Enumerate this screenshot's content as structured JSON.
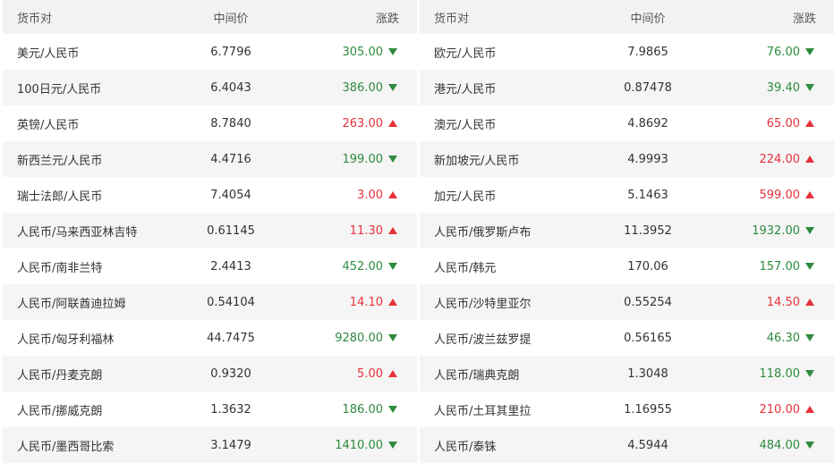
{
  "headers": {
    "pair": "货币对",
    "mid": "中间价",
    "change": "涨跌"
  },
  "colors": {
    "down": "#2e8b3e",
    "up": "#e8313b",
    "header_bg": "#f2f2f2",
    "row_alt_bg": "#f5f5f5"
  },
  "left": [
    {
      "pair": "美元/人民币",
      "mid": "6.7796",
      "change": "305.00",
      "dir": "down"
    },
    {
      "pair": "100日元/人民币",
      "mid": "6.4043",
      "change": "386.00",
      "dir": "down"
    },
    {
      "pair": "英镑/人民币",
      "mid": "8.7840",
      "change": "263.00",
      "dir": "up"
    },
    {
      "pair": "新西兰元/人民币",
      "mid": "4.4716",
      "change": "199.00",
      "dir": "down"
    },
    {
      "pair": "瑞士法郎/人民币",
      "mid": "7.4054",
      "change": "3.00",
      "dir": "up"
    },
    {
      "pair": "人民币/马来西亚林吉特",
      "mid": "0.61145",
      "change": "11.30",
      "dir": "up"
    },
    {
      "pair": "人民币/南非兰特",
      "mid": "2.4413",
      "change": "452.00",
      "dir": "down"
    },
    {
      "pair": "人民币/阿联酋迪拉姆",
      "mid": "0.54104",
      "change": "14.10",
      "dir": "up"
    },
    {
      "pair": "人民币/匈牙利福林",
      "mid": "44.7475",
      "change": "9280.00",
      "dir": "down"
    },
    {
      "pair": "人民币/丹麦克朗",
      "mid": "0.9320",
      "change": "5.00",
      "dir": "up"
    },
    {
      "pair": "人民币/挪威克朗",
      "mid": "1.3632",
      "change": "186.00",
      "dir": "down"
    },
    {
      "pair": "人民币/墨西哥比索",
      "mid": "3.1479",
      "change": "1410.00",
      "dir": "down"
    }
  ],
  "right": [
    {
      "pair": "欧元/人民币",
      "mid": "7.9865",
      "change": "76.00",
      "dir": "down"
    },
    {
      "pair": "港元/人民币",
      "mid": "0.87478",
      "change": "39.40",
      "dir": "down"
    },
    {
      "pair": "澳元/人民币",
      "mid": "4.8692",
      "change": "65.00",
      "dir": "up"
    },
    {
      "pair": "新加坡元/人民币",
      "mid": "4.9993",
      "change": "224.00",
      "dir": "up"
    },
    {
      "pair": "加元/人民币",
      "mid": "5.1463",
      "change": "599.00",
      "dir": "up"
    },
    {
      "pair": "人民币/俄罗斯卢布",
      "mid": "11.3952",
      "change": "1932.00",
      "dir": "down"
    },
    {
      "pair": "人民币/韩元",
      "mid": "170.06",
      "change": "157.00",
      "dir": "down"
    },
    {
      "pair": "人民币/沙特里亚尔",
      "mid": "0.55254",
      "change": "14.50",
      "dir": "up"
    },
    {
      "pair": "人民币/波兰兹罗提",
      "mid": "0.56165",
      "change": "46.30",
      "dir": "down"
    },
    {
      "pair": "人民币/瑞典克朗",
      "mid": "1.3048",
      "change": "118.00",
      "dir": "down"
    },
    {
      "pair": "人民币/土耳其里拉",
      "mid": "1.16955",
      "change": "210.00",
      "dir": "up"
    },
    {
      "pair": "人民币/泰铢",
      "mid": "4.5944",
      "change": "484.00",
      "dir": "down"
    }
  ]
}
